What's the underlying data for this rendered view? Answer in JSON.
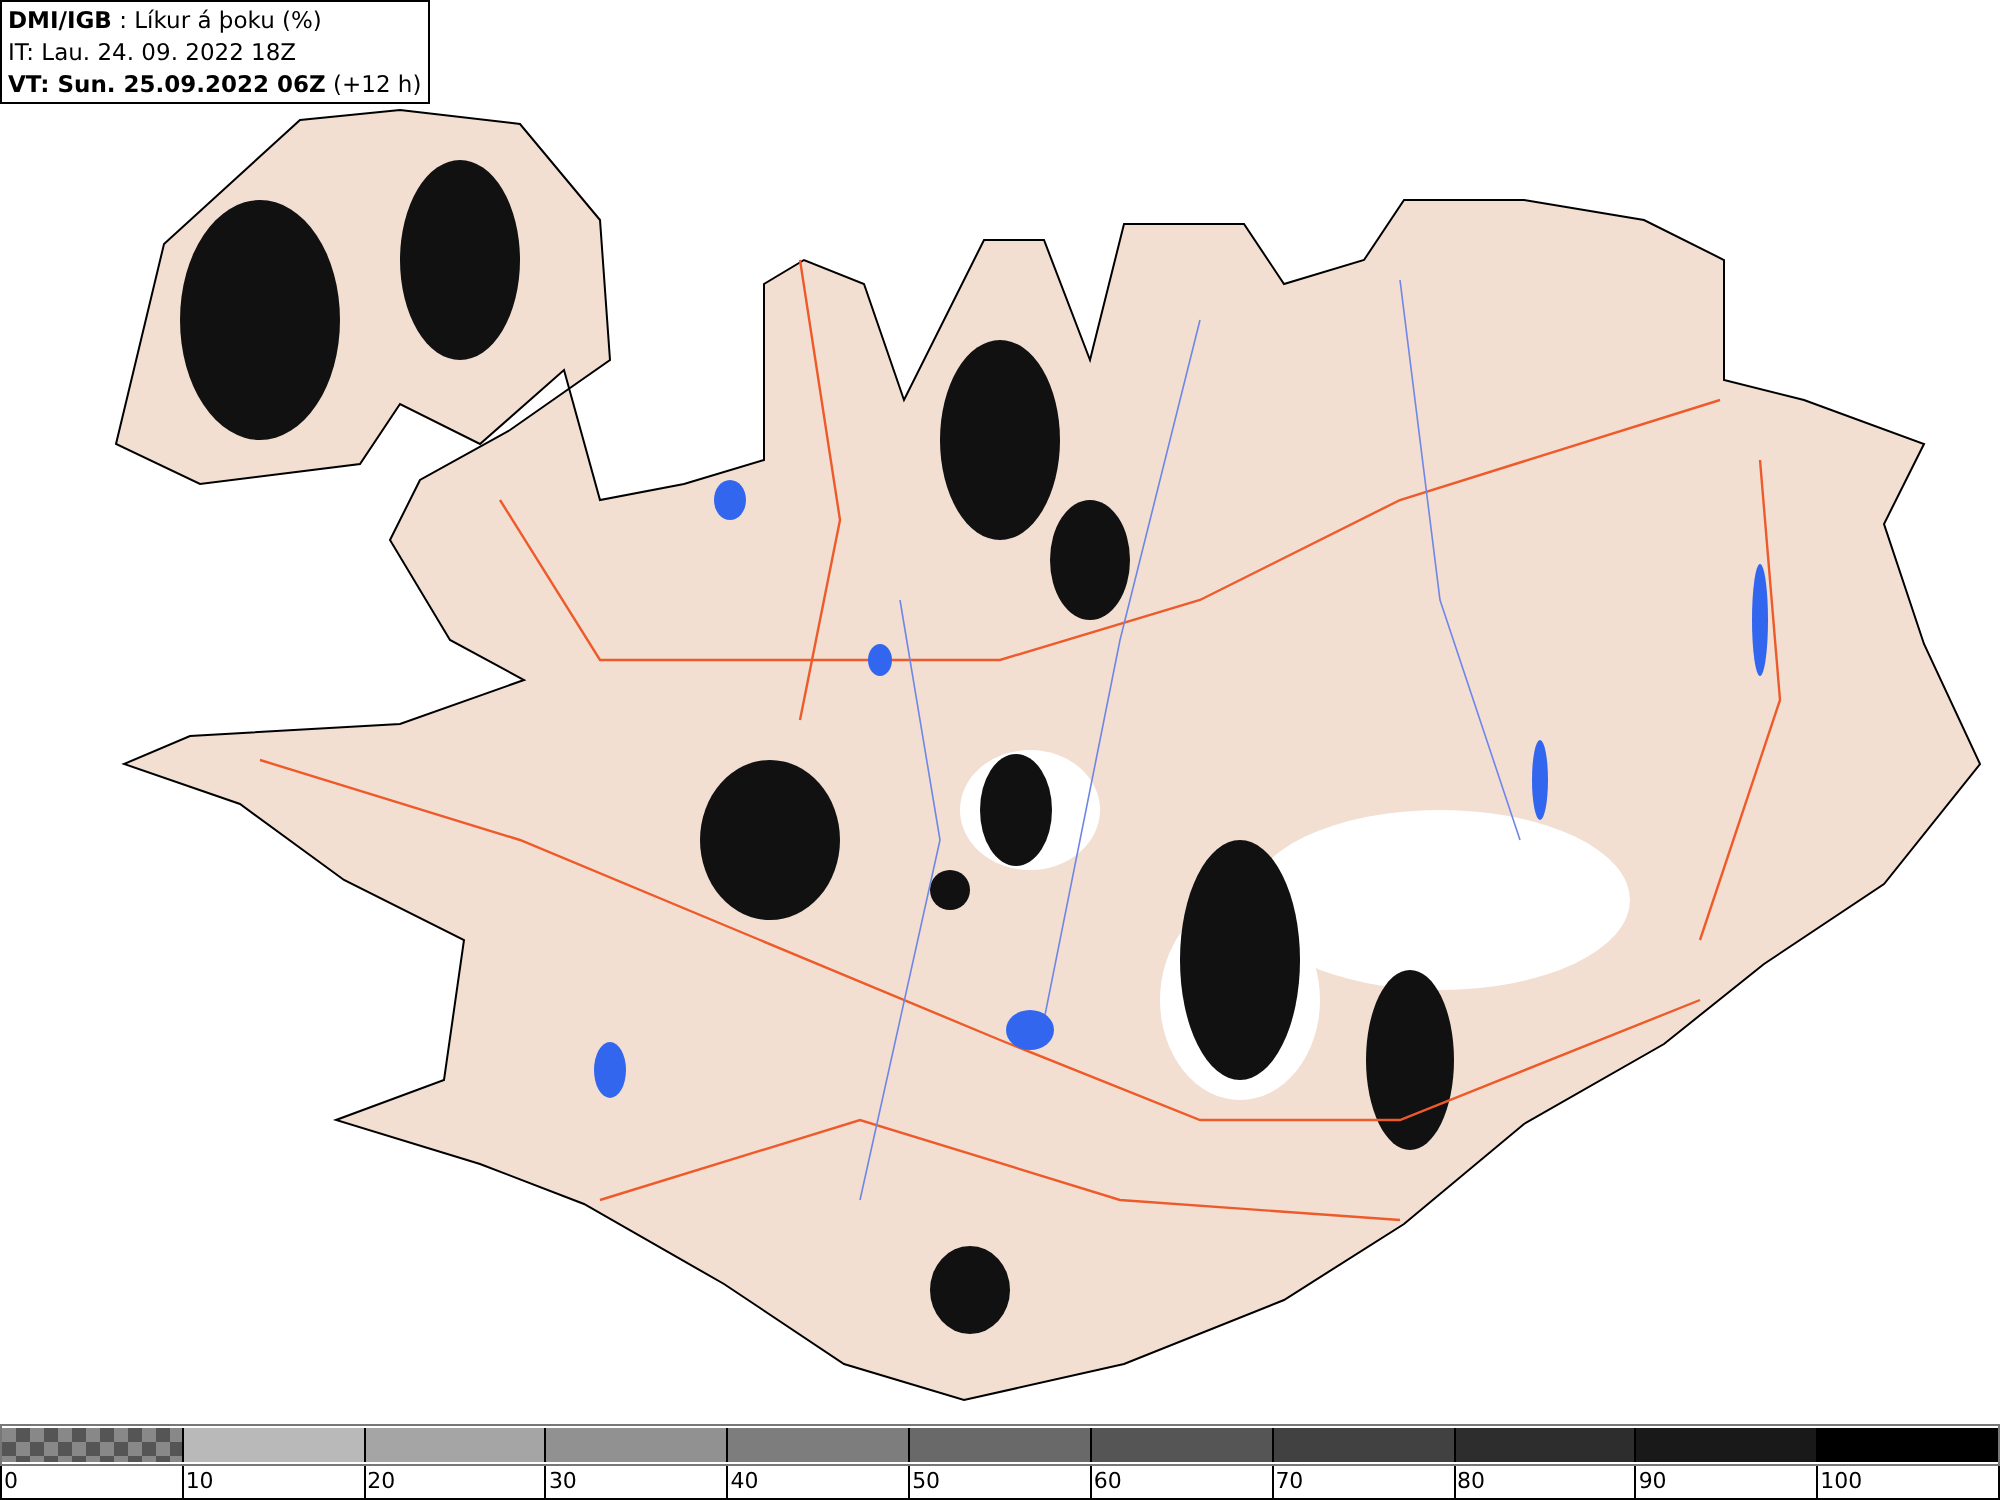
{
  "header": {
    "line_1": "**DMI/IGB** : Líkur á þoku (%)",
    "line_2": "IT: Lau. 24. 09. 2022 18Z",
    "line_3": "**VT: Sun. 25.09.2022 06Z** (+12 h)"
  },
  "legend": {
    "segments": [
      {
        "kind": "checker",
        "label": "0"
      },
      {
        "kind": "solid",
        "color": "#b9b9b9",
        "label": "10"
      },
      {
        "kind": "solid",
        "color": "#a5a5a5",
        "label": "20"
      },
      {
        "kind": "solid",
        "color": "#919191",
        "label": "30"
      },
      {
        "kind": "solid",
        "color": "#7d7d7d",
        "label": "40"
      },
      {
        "kind": "solid",
        "color": "#696969",
        "label": "50"
      },
      {
        "kind": "solid",
        "color": "#555555",
        "label": "60"
      },
      {
        "kind": "solid",
        "color": "#414141",
        "label": "70"
      },
      {
        "kind": "solid",
        "color": "#2d2d2d",
        "label": "80"
      },
      {
        "kind": "solid",
        "color": "#191919",
        "label": "90"
      },
      {
        "kind": "solid",
        "color": "#000000",
        "label": "100"
      }
    ]
  }
}
